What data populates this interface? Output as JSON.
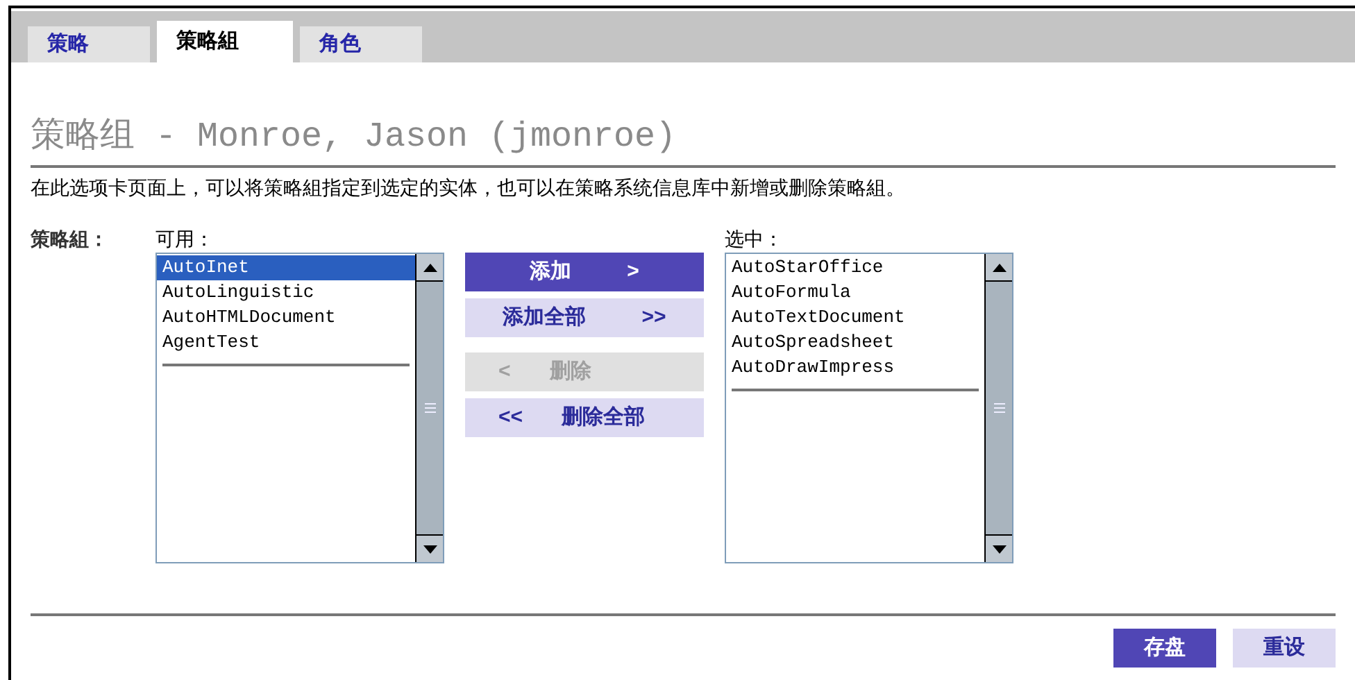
{
  "tabs": [
    {
      "label": "策略",
      "selected": false
    },
    {
      "label": "策略組",
      "selected": true
    },
    {
      "label": "角色",
      "selected": false
    }
  ],
  "title": "策略组 - Monroe, Jason (jmonroe)",
  "description": "在此选项卡页面上，可以将策略組指定到选定的实体，也可以在策略系统信息库中新增或删除策略組。",
  "field_label": "策略組：",
  "available": {
    "label": "可用：",
    "items": [
      {
        "text": "AutoInet",
        "selected": true
      },
      {
        "text": "AutoLinguistic",
        "selected": false
      },
      {
        "text": "AutoHTMLDocument",
        "selected": false
      },
      {
        "text": "AgentTest",
        "selected": false
      }
    ]
  },
  "move_buttons": [
    {
      "label": "添加",
      "arrow_right": ">",
      "kind": "primary"
    },
    {
      "label": "添加全部",
      "arrow_right": ">>",
      "kind": "secondary"
    },
    {
      "arrow_left": "<",
      "label": "删除",
      "kind": "disabled"
    },
    {
      "arrow_left": "<<",
      "label": "删除全部",
      "kind": "secondary"
    }
  ],
  "chosen": {
    "label": "选中：",
    "items": [
      {
        "text": "AutoStarOffice",
        "selected": false
      },
      {
        "text": "AutoFormula",
        "selected": false
      },
      {
        "text": "AutoTextDocument",
        "selected": false
      },
      {
        "text": "AutoSpreadsheet",
        "selected": false
      },
      {
        "text": "AutoDrawImpress",
        "selected": false
      }
    ]
  },
  "footer_buttons": [
    {
      "label": "存盘",
      "kind": "primary"
    },
    {
      "label": "重设",
      "kind": "secondary"
    }
  ]
}
